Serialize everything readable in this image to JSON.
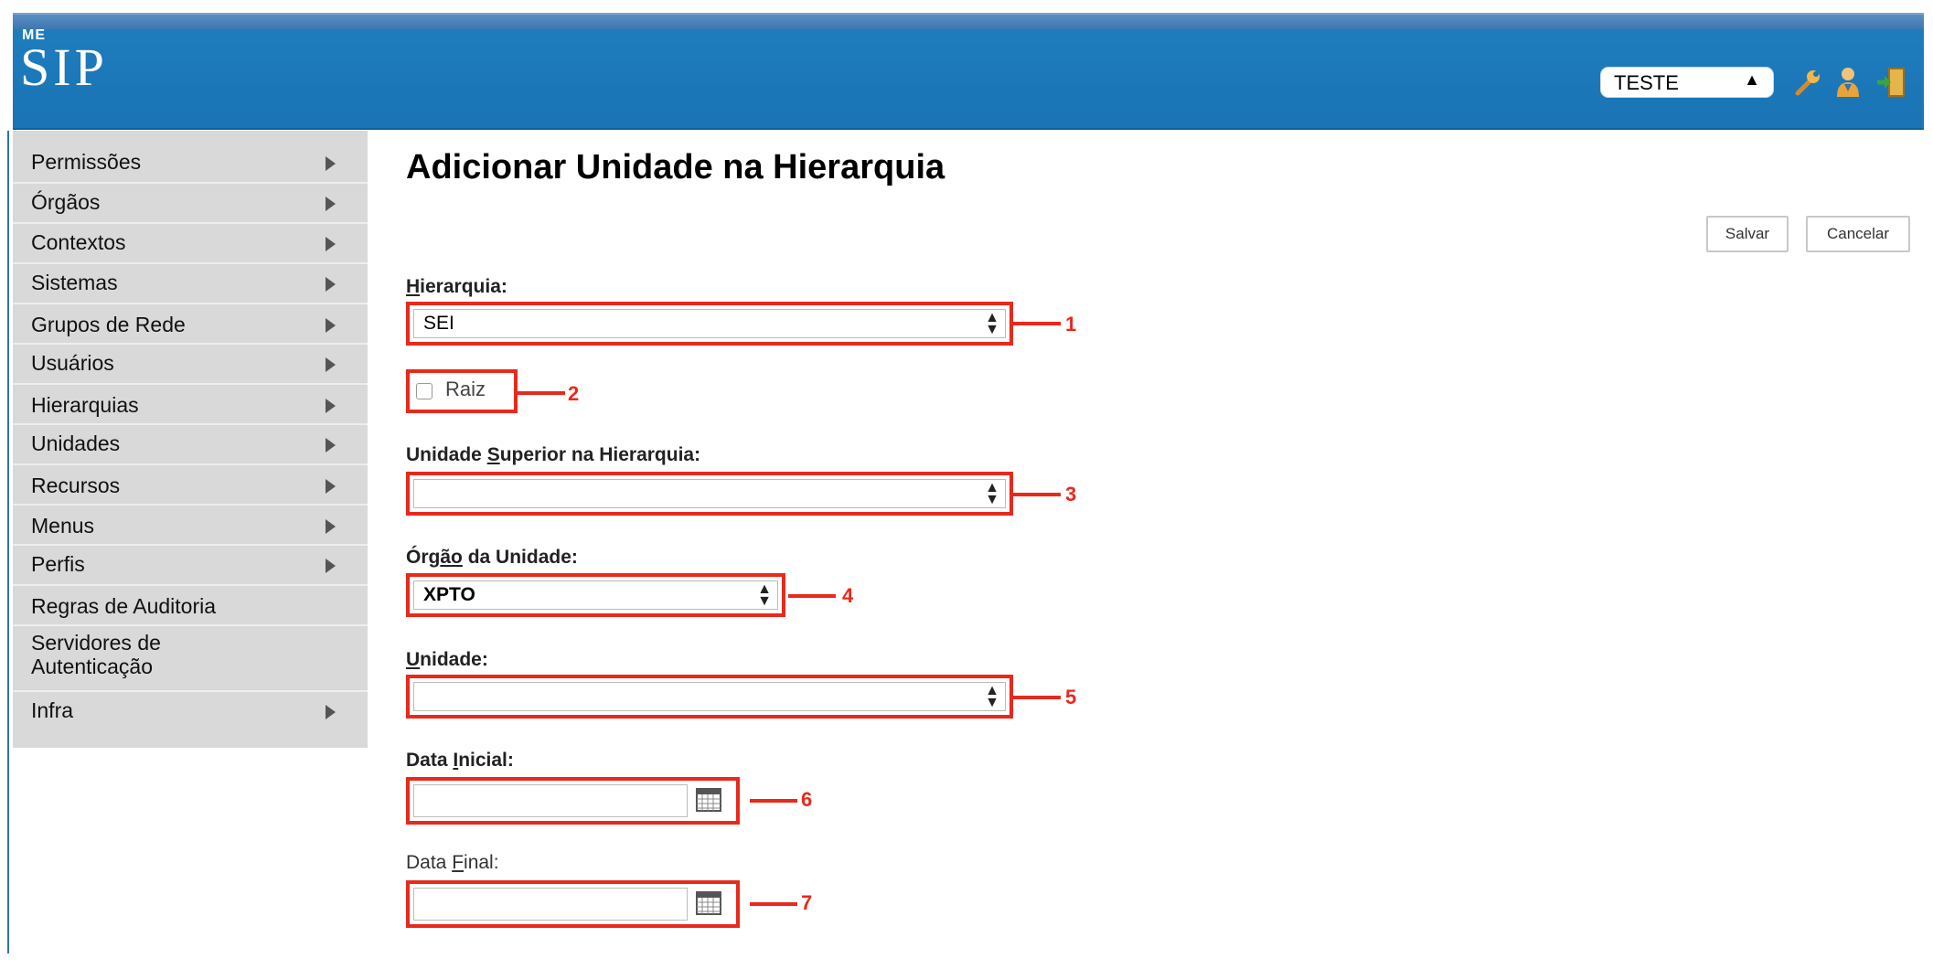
{
  "header": {
    "system": "ME",
    "logo": "SIP",
    "context_select": "TESTE",
    "icons": [
      "wrench-icon",
      "user-icon",
      "exit-icon"
    ]
  },
  "sidebar": {
    "items": [
      {
        "label": "Permissões",
        "has_submenu": true
      },
      {
        "label": "Órgãos",
        "has_submenu": true
      },
      {
        "label": "Contextos",
        "has_submenu": true
      },
      {
        "label": "Sistemas",
        "has_submenu": true
      },
      {
        "label": "Grupos de Rede",
        "has_submenu": true
      },
      {
        "label": "Usuários",
        "has_submenu": true
      },
      {
        "label": "Hierarquias",
        "has_submenu": true
      },
      {
        "label": "Unidades",
        "has_submenu": true
      },
      {
        "label": "Recursos",
        "has_submenu": true
      },
      {
        "label": "Menus",
        "has_submenu": true
      },
      {
        "label": "Perfis",
        "has_submenu": true
      },
      {
        "label": "Regras de Auditoria",
        "has_submenu": false
      },
      {
        "label": "Servidores de",
        "label2": "Autenticação",
        "has_submenu": false
      },
      {
        "label": "Infra",
        "has_submenu": true
      }
    ]
  },
  "main": {
    "title": "Adicionar Unidade na Hierarquia",
    "save_label": "Salvar",
    "cancel_label": "Cancelar",
    "fields": {
      "hierarquia": {
        "label_u": "H",
        "label_rest": "ierarquia:",
        "value": "SEI",
        "callout": "1"
      },
      "raiz": {
        "label": "Raiz",
        "checked": false,
        "callout": "2"
      },
      "unidade_superior": {
        "label_pre": "Unidade ",
        "label_u": "S",
        "label_rest": "uperior na Hierarquia:",
        "value": "",
        "callout": "3"
      },
      "orgao": {
        "label_pre": "Órg",
        "label_u": "ã",
        "label_mid": "o",
        "label_rest": " da Unidade:",
        "value": "XPTO",
        "callout": "4"
      },
      "unidade": {
        "label_u": "U",
        "label_rest": "nidade:",
        "value": "",
        "callout": "5"
      },
      "data_inicial": {
        "label_pre": "Data ",
        "label_u": "I",
        "label_rest": "nicial:",
        "value": "",
        "callout": "6"
      },
      "data_final": {
        "label_pre": "Data ",
        "label_u": "F",
        "label_rest": "inal:",
        "value": "",
        "callout": "7"
      }
    }
  },
  "colors": {
    "header_blue": "#1a73b4",
    "annotation_red": "#e8291c",
    "sidebar_gray": "#d9d9d9"
  }
}
